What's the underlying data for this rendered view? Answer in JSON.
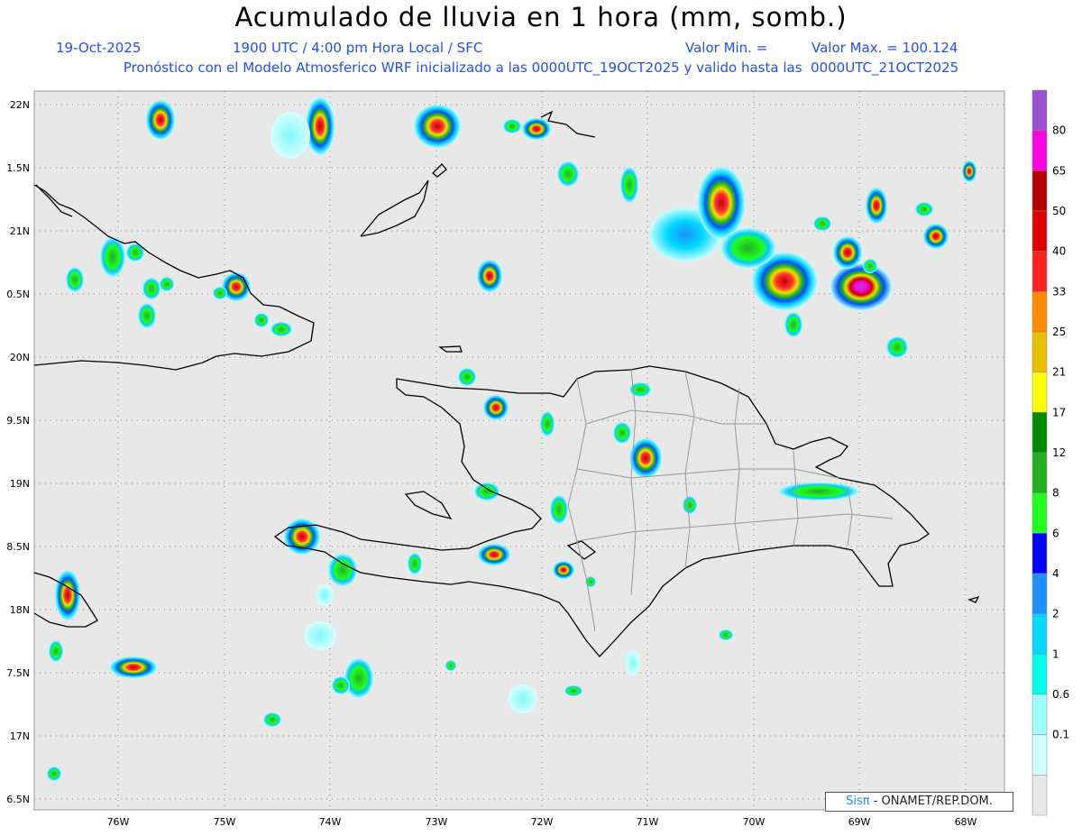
{
  "header": {
    "title": "Acumulado de lluvia en 1 hora (mm, somb.)",
    "date": "19-Oct-2025",
    "time": "1900 UTC / 4:00 pm Hora Local / SFC",
    "valmin": "Valor Min. =",
    "valmax": "Valor Max. = 100.124",
    "model_line": "Pronóstico con el Modelo Atmosferico WRF inicializado a las 0000UTC_19OCT2025 y valido hasta las  0000UTC_21OCT2025"
  },
  "map": {
    "background": "#e8e8e8",
    "lat_labels": [
      "22N",
      "1.5N",
      "21N",
      "0.5N",
      "20N",
      "9.5N",
      "19N",
      "8.5N",
      "18N",
      "7.5N",
      "17N",
      "6.5N"
    ],
    "lon_labels": [
      "76W",
      "75W",
      "74W",
      "73W",
      "72W",
      "71W",
      "70W",
      "69W",
      "68W"
    ]
  },
  "colorbar": {
    "labels": [
      "80",
      "65",
      "50",
      "40",
      "33",
      "25",
      "21",
      "17",
      "12",
      "8",
      "6",
      "4",
      "2",
      "1",
      "0.6",
      "0.1"
    ],
    "colors": [
      "#9a4fd1",
      "#ff00e0",
      "#b40000",
      "#e00000",
      "#ff2020",
      "#ff8c00",
      "#e8c000",
      "#ffff00",
      "#008c00",
      "#22b022",
      "#20ff20",
      "#0000ff",
      "#1e90ff",
      "#00d8ff",
      "#00ffe8",
      "#a0ffff",
      "#d0ffff",
      "#e8e8e8"
    ]
  },
  "credit": {
    "brand": "Sisπ",
    "text": "- ONAMET/REP.DOM."
  }
}
